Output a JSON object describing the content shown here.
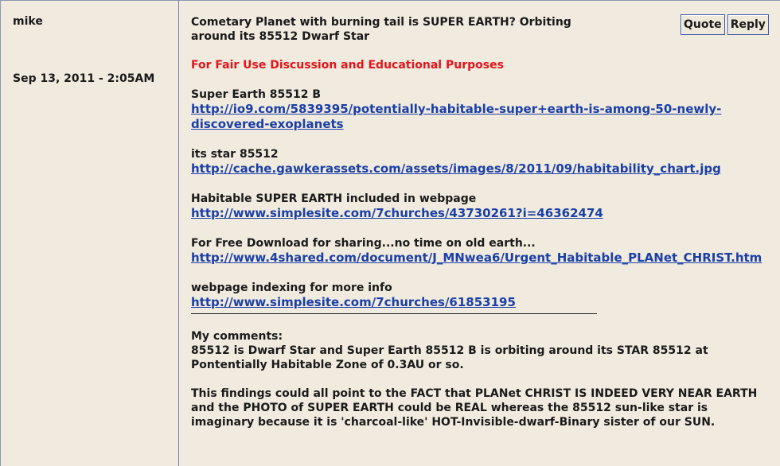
{
  "author": "mike",
  "date": "Sep 13, 2011 - 2:05AM",
  "buttons": {
    "quote": "Quote",
    "reply": "Reply"
  },
  "post": {
    "title": "Cometary Planet with burning tail is SUPER EARTH? Orbiting around its 85512 Dwarf Star",
    "notice": "For Fair Use Discussion and Educational Purposes",
    "blocks": [
      {
        "label": "Super Earth 85512 B",
        "link": "http://io9.com/5839395/potentially-habitable-super+earth-is-among-50-newly-discovered-exoplanets"
      },
      {
        "label": "its star 85512",
        "link": "http://cache.gawkerassets.com/assets/images/8/2011/09/habitability_chart.jpg"
      },
      {
        "label": "Habitable SUPER EARTH included in webpage",
        "link": "http://www.simplesite.com/7churches/43730261?i=46362474"
      },
      {
        "label": "For Free Download for sharing...no time on old earth...",
        "link": "http://www.4shared.com/document/J_MNwea6/Urgent_Habitable_PLANet_CHRIST.htm"
      },
      {
        "label": "webpage indexing for more info",
        "link": "http://www.simplesite.com/7churches/61853195"
      }
    ],
    "comments_heading": "My comments:",
    "comments_p1": "85512 is Dwarf Star and Super Earth 85512 B is orbiting around its STAR 85512 at Pontentially Habitable Zone of 0.3AU or so.",
    "comments_p2": "This findings could all point to the FACT that PLANet CHRIST IS INDEED VERY NEAR EARTH and the PHOTO of SUPER EARTH could be REAL whereas the 85512 sun-like star is imaginary because it is 'charcoal-like' HOT-Invisible-dwarf-Binary sister of our SUN."
  }
}
